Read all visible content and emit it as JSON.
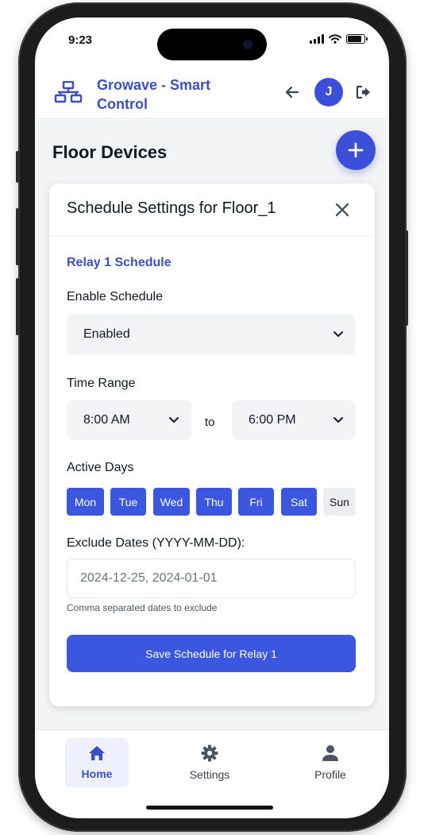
{
  "status_bar": {
    "time": "9:23"
  },
  "header": {
    "app_title": "Growave - Smart Control",
    "icons": [
      "network-logo-icon",
      "arrow-left-icon",
      "logout-icon"
    ],
    "avatar_initial": "J"
  },
  "page": {
    "title": "Floor Devices"
  },
  "modal": {
    "title": "Schedule Settings for Floor_1",
    "section_title": "Relay 1 Schedule",
    "enable_schedule": {
      "label": "Enable Schedule",
      "value": "Enabled"
    },
    "time_range": {
      "label": "Time Range",
      "start": "8:00 AM",
      "separator": "to",
      "end": "6:00 PM"
    },
    "active_days": {
      "label": "Active Days",
      "days": [
        {
          "label": "Mon",
          "active": true
        },
        {
          "label": "Tue",
          "active": true
        },
        {
          "label": "Wed",
          "active": true
        },
        {
          "label": "Thu",
          "active": true
        },
        {
          "label": "Fri",
          "active": true
        },
        {
          "label": "Sat",
          "active": true
        },
        {
          "label": "Sun",
          "active": false
        }
      ]
    },
    "exclude_dates": {
      "label": "Exclude Dates (YYYY-MM-DD):",
      "value": "",
      "placeholder": "2024-12-25, 2024-01-01",
      "helper": "Comma separated dates to exclude"
    },
    "save_label": "Save Schedule for Relay 1"
  },
  "bottom_nav": {
    "items": [
      {
        "label": "Home",
        "icon": "home-icon",
        "active": true
      },
      {
        "label": "Settings",
        "icon": "gear-icon",
        "active": false
      },
      {
        "label": "Profile",
        "icon": "user-icon",
        "active": false
      }
    ]
  },
  "colors": {
    "accent": "#3b57e0",
    "title_blue": "#3b4fc4",
    "inactive_day": "#eceef1"
  }
}
